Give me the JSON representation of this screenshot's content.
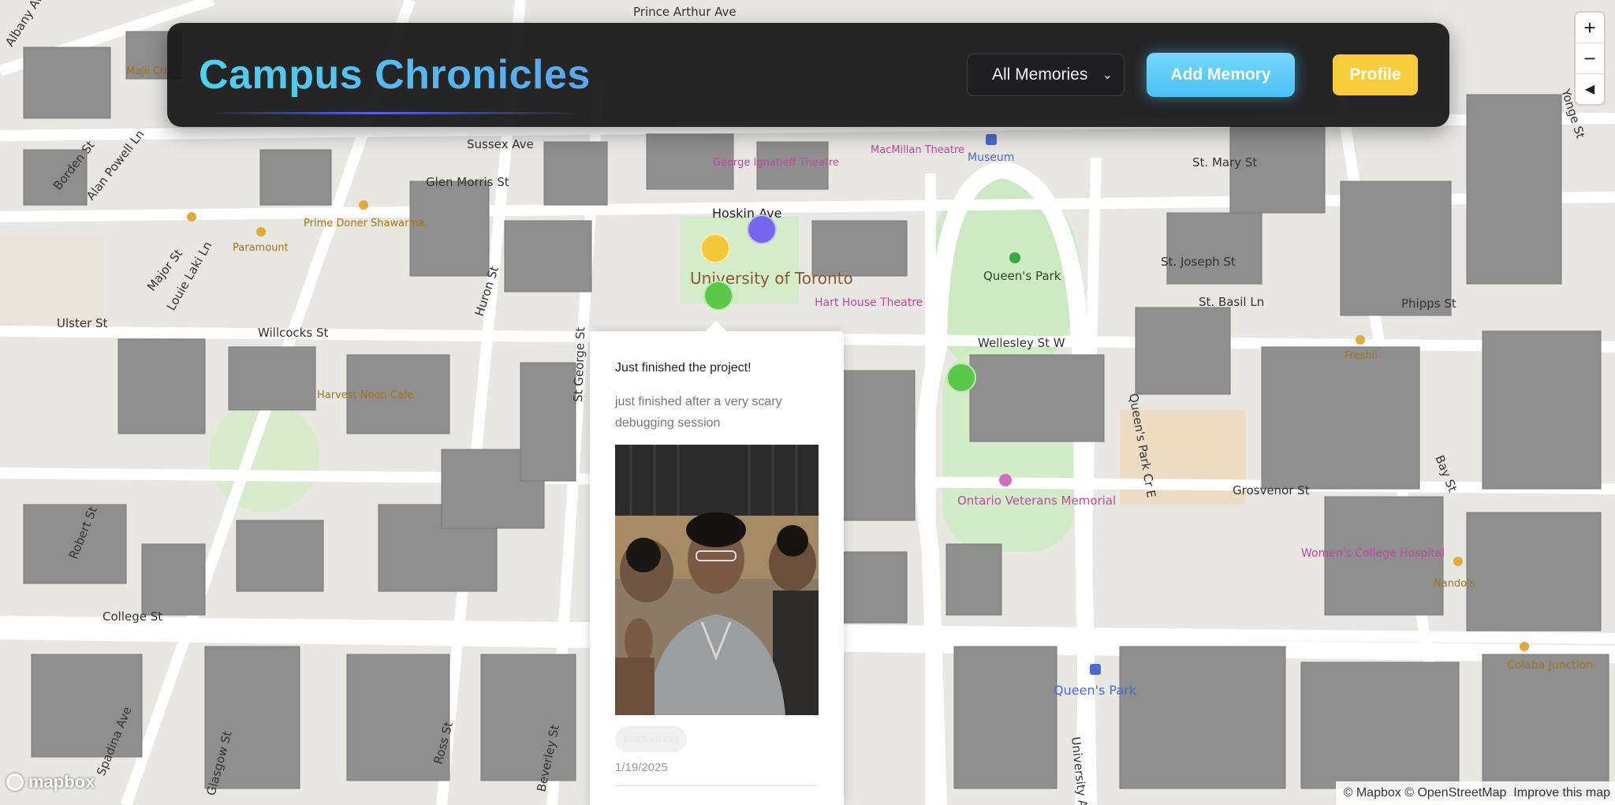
{
  "header": {
    "title": "Campus Chronicles",
    "filter": {
      "selected": "All Memories"
    },
    "add_button": "Add Memory",
    "profile_button": "Profile"
  },
  "map_controls": {
    "zoom_in": "+",
    "zoom_out": "−",
    "compass": "◀"
  },
  "map": {
    "streets": [
      "Prince Arthur Ave",
      "Sussex Ave",
      "Glen Morris St",
      "Hoskin Ave",
      "Borden St",
      "Alan Powell Ln",
      "Major St",
      "Louie Laki Ln",
      "Willcocks St",
      "Huron St",
      "St. Mary St",
      "St. Joseph St",
      "St. Basil Ln",
      "Phipps St",
      "Wellesley St W",
      "Queen's Park Cr E",
      "Grosvenor St",
      "Bay St",
      "Ulster St",
      "Robert St",
      "College St",
      "Spadina Ave",
      "Glasgow St",
      "Ross St",
      "Beverley St",
      "University Ave",
      "Albany Ave",
      "Yonge St",
      "St George St"
    ],
    "places": [
      "University of Toronto",
      "Queen's Park",
      "Hart House Theatre",
      "George Ignatieff Theatre",
      "MacMillan Theatre",
      "Museum",
      "Prime Doner Shawarma",
      "Ontario Veterans Memorial",
      "Women's College Hospital",
      "Queen's Park",
      "Freshii",
      "Nando's",
      "Colaba Junction",
      "Harvest Noon Cafe",
      "Paramount",
      "Majii Curry"
    ]
  },
  "markers": [
    {
      "color": "#f3c93a"
    },
    {
      "color": "#7566ee"
    },
    {
      "color": "#5bc748"
    },
    {
      "color": "#5bc748"
    }
  ],
  "popup": {
    "title": "Just finished the project!",
    "description": "just finished after a very scary debugging session",
    "tag": "hackathon",
    "date": "1/19/2025"
  },
  "footer": {
    "logo": "mapbox",
    "attribution": "© Mapbox © OpenStreetMap  Improve this map"
  }
}
